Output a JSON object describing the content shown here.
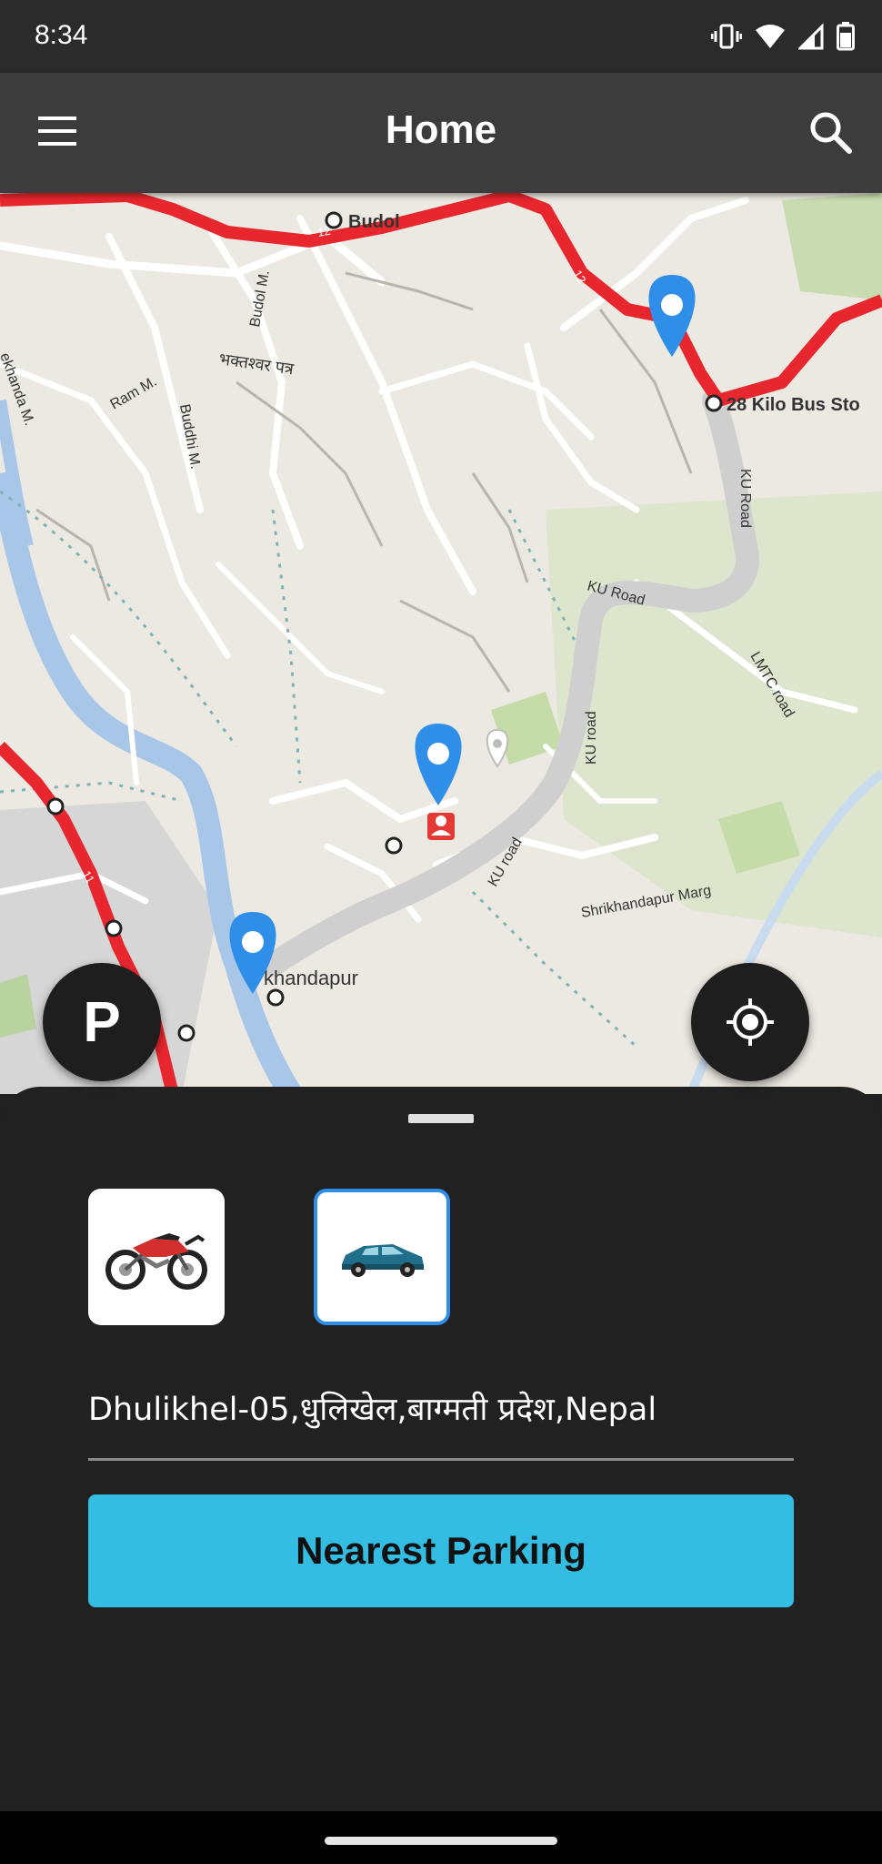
{
  "status_bar": {
    "time": "8:34",
    "icons": [
      "vibrate-icon",
      "wifi-icon",
      "signal-icon",
      "battery-icon"
    ]
  },
  "app_bar": {
    "title": "Home",
    "menu_icon": "menu-icon",
    "search_icon": "search-icon"
  },
  "map": {
    "labels": {
      "budol": "Budol",
      "bus_stop": "28 Kilo Bus Sto",
      "budol_m": "Budol M.",
      "ram_m": "Ram M.",
      "bhaktasheswar": "भक्तश्वर पत्र",
      "buddhi_m": "Buddhi M.",
      "ku_road_1": "KU Road",
      "ku_road_2": "KU Road",
      "ku_road_3": "KU road",
      "ku_road_4": "KU road",
      "lmtc_road": "LMTC road",
      "shrikhandapur_marg": "Shrikhandapur Marg",
      "khandapur": "khandapur",
      "ekhanda": "ekhanda M."
    },
    "pin_color": "#2f8ee8",
    "route_color": "#e8262e"
  },
  "fab": {
    "parking_label": "P",
    "locate_icon": "gps-locate-icon"
  },
  "sheet": {
    "vehicles": [
      {
        "name": "motorcycle",
        "icon": "motorcycle-icon",
        "selected": false
      },
      {
        "name": "car",
        "icon": "car-icon",
        "selected": true
      }
    ],
    "address": "Dhulikhel-05,धुलिखेल,बाग्मती प्रदेश,Nepal",
    "button_label": "Nearest Parking",
    "accent": "#33bde3"
  }
}
